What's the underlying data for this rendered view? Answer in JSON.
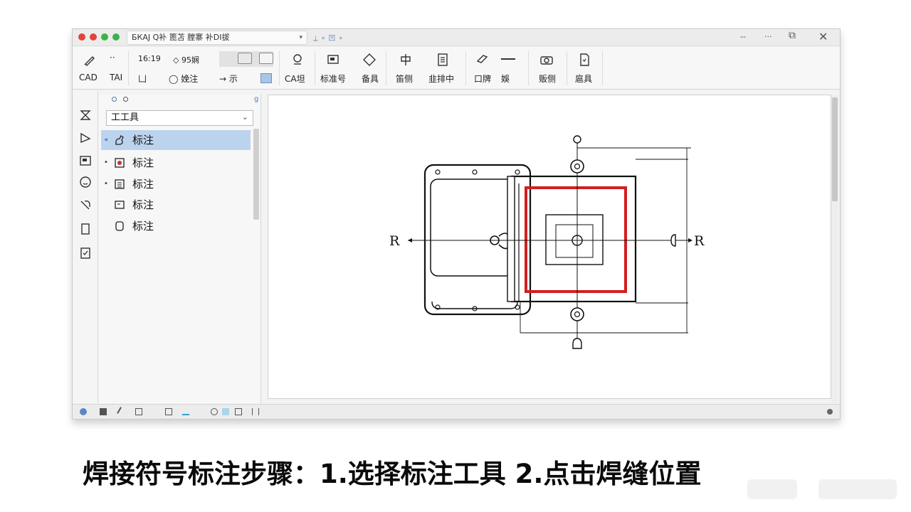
{
  "window": {
    "tab_title": "БКАJ  Q补 篦苫  膛寨  补DI拔",
    "title_extra": "⟂  ⚬ 凹 ⚬",
    "controls": {
      "minimize": "--",
      "more": "···",
      "restore": "⧉",
      "close": "✕"
    }
  },
  "ribbon": {
    "tools": [
      {
        "label": "CAD",
        "top_label": ""
      },
      {
        "label": "TAI",
        "top_label": "··"
      },
      {
        "label": "凵",
        "top_label": "16:19"
      },
      {
        "label": "◯ 娩注",
        "top_label": "◇  95娴"
      },
      {
        "label": "→  示",
        "top_label": ""
      },
      {
        "label": "CA坦",
        "top_label": ""
      },
      {
        "label": "标准号",
        "top_label": ""
      },
      {
        "label": "备具",
        "top_label": ""
      },
      {
        "label": "笛侧",
        "top_label": ""
      },
      {
        "label": "韭排中",
        "top_label": ""
      },
      {
        "label": "口牌",
        "top_label": ""
      },
      {
        "label": "娛",
        "top_label": ""
      },
      {
        "label": "贩侧",
        "top_label": ""
      },
      {
        "label": "扈具",
        "top_label": ""
      }
    ]
  },
  "panel": {
    "dropdown_value": "工工具",
    "items": [
      {
        "label": "标注",
        "selected": true,
        "icon": "hand-annotation-icon"
      },
      {
        "label": "标注",
        "selected": false,
        "icon": "weld-symbol-icon"
      },
      {
        "label": "标注",
        "selected": false,
        "icon": "list-icon"
      },
      {
        "label": "标注",
        "selected": false,
        "icon": "text-box-icon"
      },
      {
        "label": "标注",
        "selected": false,
        "icon": "rounded-square-icon"
      }
    ]
  },
  "drawing": {
    "left_label": "R",
    "right_label": "R",
    "highlight_color": "#d21f1f"
  },
  "caption": {
    "text": "焊接符号标注步骤：1.选择标注工具   2.点击焊缝位置"
  },
  "colors": {
    "accent": "#bcd3ee",
    "traffic_red": "#e0443a",
    "traffic_green": "#3cb34a"
  }
}
